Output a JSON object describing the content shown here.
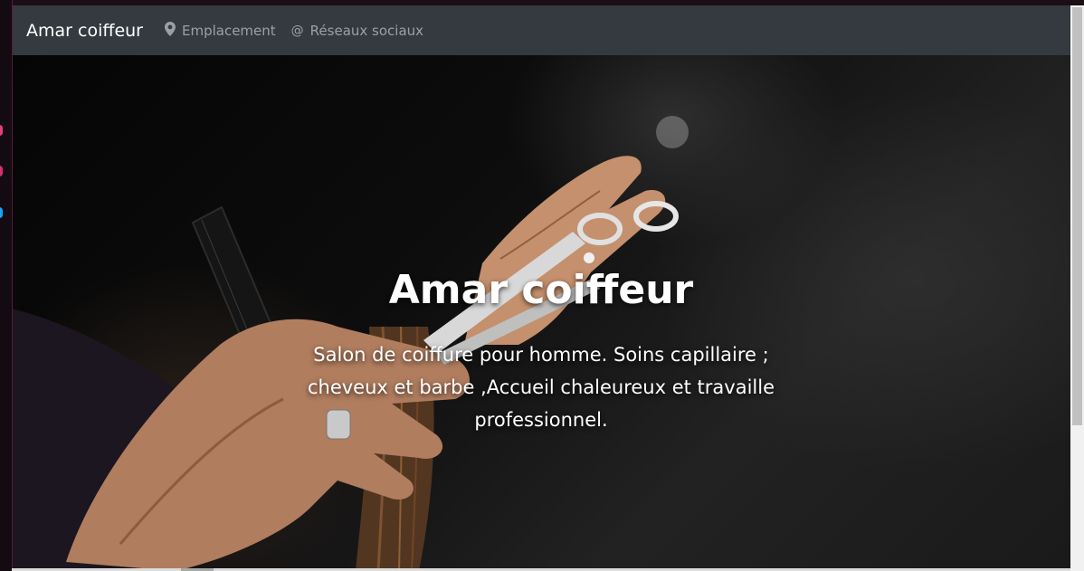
{
  "navbar": {
    "brand": "Amar coiffeur",
    "links": [
      {
        "label": "Emplacement",
        "icon": "map-marker-icon"
      },
      {
        "label": "Réseaux sociaux",
        "icon": "at-sign-icon"
      }
    ],
    "background": "#343a40"
  },
  "hero": {
    "title": "Amar coiffeur",
    "description": "Salon de coiffure pour homme. Soins capillaire ; cheveux et barbe ,Accueil chaleureux et travaille professionnel.",
    "image": "hairdresser-scissors-comb-photo"
  },
  "sidebar_dots": [
    {
      "color": "#e0407a"
    },
    {
      "color": "#d4306e"
    },
    {
      "color": "#1da1f2"
    }
  ]
}
